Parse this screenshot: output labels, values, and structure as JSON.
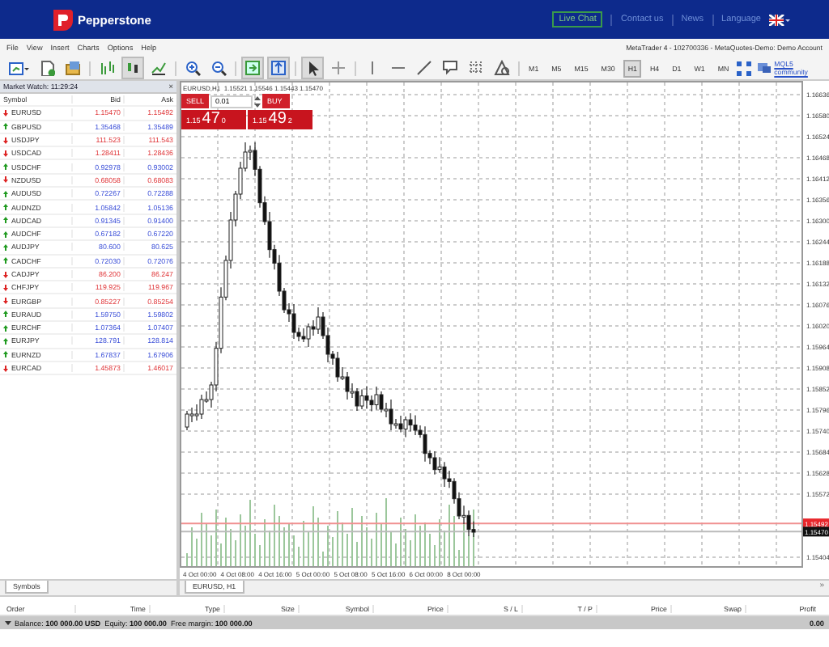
{
  "header": {
    "brand": "Pepperstone",
    "live_chat": "Live Chat",
    "links": [
      "Contact us",
      "News",
      "Language"
    ]
  },
  "menu": [
    "File",
    "View",
    "Insert",
    "Charts",
    "Options",
    "Help"
  ],
  "account": "MetaTrader 4 - 102700336 - MetaQuotes-Demo: Demo Account",
  "timeframes": [
    {
      "label": "M1",
      "selected": false
    },
    {
      "label": "M5",
      "selected": false
    },
    {
      "label": "M15",
      "selected": false
    },
    {
      "label": "M30",
      "selected": false
    },
    {
      "label": "H1",
      "selected": true
    },
    {
      "label": "H4",
      "selected": false
    },
    {
      "label": "D1",
      "selected": false
    },
    {
      "label": "W1",
      "selected": false
    },
    {
      "label": "MN",
      "selected": false
    }
  ],
  "community_link": "MQL5 community",
  "market_watch": {
    "title": "Market Watch: 11:29:24",
    "close": "×",
    "columns": [
      "Symbol",
      "Bid",
      "Ask"
    ],
    "rows": [
      {
        "symbol": "EURUSD",
        "bid": "1.15470",
        "ask": "1.15492",
        "rising": false
      },
      {
        "symbol": "GBPUSD",
        "bid": "1.35468",
        "ask": "1.35489",
        "rising": true
      },
      {
        "symbol": "USDJPY",
        "bid": "111.523",
        "ask": "111.543",
        "rising": false
      },
      {
        "symbol": "USDCAD",
        "bid": "1.28411",
        "ask": "1.28436",
        "rising": false
      },
      {
        "symbol": "USDCHF",
        "bid": "0.92978",
        "ask": "0.93002",
        "rising": true
      },
      {
        "symbol": "NZDUSD",
        "bid": "0.68058",
        "ask": "0.68083",
        "rising": false
      },
      {
        "symbol": "AUDUSD",
        "bid": "0.72267",
        "ask": "0.72288",
        "rising": true
      },
      {
        "symbol": "AUDNZD",
        "bid": "1.05842",
        "ask": "1.05136",
        "rising": true
      },
      {
        "symbol": "AUDCAD",
        "bid": "0.91345",
        "ask": "0.91400",
        "rising": true
      },
      {
        "symbol": "AUDCHF",
        "bid": "0.67182",
        "ask": "0.67220",
        "rising": true
      },
      {
        "symbol": "AUDJPY",
        "bid": "80.600",
        "ask": "80.625",
        "rising": true
      },
      {
        "symbol": "CADCHF",
        "bid": "0.72030",
        "ask": "0.72076",
        "rising": true
      },
      {
        "symbol": "CADJPY",
        "bid": "86.200",
        "ask": "86.247",
        "rising": false
      },
      {
        "symbol": "CHFJPY",
        "bid": "119.925",
        "ask": "119.967",
        "rising": false
      },
      {
        "symbol": "EURGBP",
        "bid": "0.85227",
        "ask": "0.85254",
        "rising": false
      },
      {
        "symbol": "EURAUD",
        "bid": "1.59750",
        "ask": "1.59802",
        "rising": true
      },
      {
        "symbol": "EURCHF",
        "bid": "1.07364",
        "ask": "1.07407",
        "rising": true
      },
      {
        "symbol": "EURJPY",
        "bid": "128.791",
        "ask": "128.814",
        "rising": true
      },
      {
        "symbol": "EURNZD",
        "bid": "1.67837",
        "ask": "1.67906",
        "rising": true
      },
      {
        "symbol": "EURCAD",
        "bid": "1.45873",
        "ask": "1.46017",
        "rising": false
      }
    ],
    "tabs": [
      {
        "label": "Symbols",
        "selected": true
      }
    ]
  },
  "chart": {
    "info": "EURUSD,H1  1.15521 1.15546 1.15443 1.15470",
    "trade": {
      "sell": "SELL",
      "buy": "BUY",
      "lot": "0.01",
      "sell_price": {
        "big": "1.15",
        "pips": "47",
        "point": "0"
      },
      "buy_price": {
        "big": "1.15",
        "pips": "49",
        "point": "2"
      }
    },
    "price_labels": [
      "1.16636",
      "1.16580",
      "1.16524",
      "1.16468",
      "1.16412",
      "1.16356",
      "1.16300",
      "1.16244",
      "1.16188",
      "1.16132",
      "1.16076",
      "1.16020",
      "1.15964",
      "1.15908",
      "1.15852",
      "1.15796",
      "1.15740",
      "1.15684",
      "1.15628",
      "1.15572",
      "1.15404"
    ],
    "ask_tag": "1.15492",
    "bid_tag": "1.15470",
    "time_labels": [
      "4 Oct 00:00",
      "4 Oct 08:00",
      "4 Oct 16:00",
      "5 Oct 00:00",
      "5 Oct 08:00",
      "5 Oct 16:00",
      "6 Oct 00:00",
      "8 Oct 00:00"
    ],
    "tabs": [
      {
        "label": "EURUSD, H1",
        "selected": true
      }
    ],
    "scroll_arrow": "»"
  },
  "terminal": {
    "columns": [
      "Order",
      "Time",
      "Type",
      "Size",
      "Symbol",
      "Price",
      "S / L",
      "T / P",
      "Price",
      "Swap",
      "Profit"
    ],
    "balance": "Balance: **100 000.00 USD**  Equity: **100 000.00**  Free margin: **100 000.00**",
    "profit": "0.00"
  }
}
